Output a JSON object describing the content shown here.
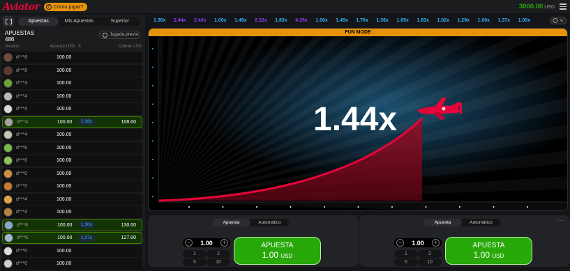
{
  "header": {
    "logo": "Aviator",
    "how_to_play": "Cómo jugar?",
    "balance": "3000.00",
    "currency": "USD"
  },
  "left_panel": {
    "tabs": [
      "Apuestas",
      "Mis Apuestas",
      "Superior"
    ],
    "active_tab": "Apuestas",
    "bets_title": "APUESTAS",
    "bets_count": "486",
    "previous_round": "Jugada previa",
    "columns": {
      "user": "Usuario",
      "bet": "Apuesta USD",
      "x": "X",
      "cashout": "Cobrar USD"
    },
    "rows": [
      {
        "user": "d***8",
        "bet": "100.00",
        "mult": "",
        "cashout": "",
        "win": false,
        "avatar": "#6e4b3a"
      },
      {
        "user": "d***8",
        "bet": "100.00",
        "mult": "",
        "cashout": "",
        "win": false,
        "avatar": "#5b3a2b"
      },
      {
        "user": "d***3",
        "bet": "100.00",
        "mult": "",
        "cashout": "",
        "win": false,
        "avatar": "#6da23a"
      },
      {
        "user": "d***4",
        "bet": "100.00",
        "mult": "",
        "cashout": "",
        "win": false,
        "avatar": "#b9b9b9"
      },
      {
        "user": "d***4",
        "bet": "100.00",
        "mult": "",
        "cashout": "",
        "win": false,
        "avatar": "#d9d9d9"
      },
      {
        "user": "d***4",
        "bet": "100.00",
        "mult": "1.08x",
        "cashout": "108.00",
        "win": true,
        "avatar": "#a7a29a"
      },
      {
        "user": "d***4",
        "bet": "100.00",
        "mult": "",
        "cashout": "",
        "win": false,
        "avatar": "#c2c8b8"
      },
      {
        "user": "d***6",
        "bet": "100.00",
        "mult": "",
        "cashout": "",
        "win": false,
        "avatar": "#7ab84a"
      },
      {
        "user": "d***6",
        "bet": "100.00",
        "mult": "",
        "cashout": "",
        "win": false,
        "avatar": "#8cc456"
      },
      {
        "user": "d***0",
        "bet": "100.00",
        "mult": "",
        "cashout": "",
        "win": false,
        "avatar": "#d28e3c"
      },
      {
        "user": "d***0",
        "bet": "100.00",
        "mult": "",
        "cashout": "",
        "win": false,
        "avatar": "#c97b2e"
      },
      {
        "user": "d***4",
        "bet": "100.00",
        "mult": "",
        "cashout": "",
        "win": false,
        "avatar": "#e0a24c"
      },
      {
        "user": "d***4",
        "bet": "100.00",
        "mult": "",
        "cashout": "",
        "win": false,
        "avatar": "#b7823d"
      },
      {
        "user": "d***6",
        "bet": "100.00",
        "mult": "1.30x",
        "cashout": "130.00",
        "win": true,
        "avatar": "#8aa8c8"
      },
      {
        "user": "d***6",
        "bet": "100.00",
        "mult": "1.27x",
        "cashout": "127.00",
        "win": true,
        "avatar": "#a3b8cc"
      },
      {
        "user": "d***0",
        "bet": "100.00",
        "mult": "",
        "cashout": "",
        "win": false,
        "avatar": "#dcdcdc"
      },
      {
        "user": "d***0",
        "bet": "100.00",
        "mult": "",
        "cashout": "",
        "win": false,
        "avatar": "#cfcfcf"
      }
    ]
  },
  "history": [
    {
      "v": "1.36x",
      "c": "#34b4ff"
    },
    {
      "v": "2.44x",
      "c": "#913ef8"
    },
    {
      "v": "2.43x",
      "c": "#913ef8"
    },
    {
      "v": "1.00x",
      "c": "#34b4ff"
    },
    {
      "v": "1.49x",
      "c": "#34b4ff"
    },
    {
      "v": "2.22x",
      "c": "#913ef8"
    },
    {
      "v": "1.83x",
      "c": "#34b4ff"
    },
    {
      "v": "4.35x",
      "c": "#913ef8"
    },
    {
      "v": "1.00x",
      "c": "#34b4ff"
    },
    {
      "v": "1.45x",
      "c": "#34b4ff"
    },
    {
      "v": "1.76x",
      "c": "#34b4ff"
    },
    {
      "v": "1.36x",
      "c": "#34b4ff"
    },
    {
      "v": "1.05x",
      "c": "#34b4ff"
    },
    {
      "v": "1.83x",
      "c": "#34b4ff"
    },
    {
      "v": "1.02x",
      "c": "#34b4ff"
    },
    {
      "v": "1.29x",
      "c": "#34b4ff"
    },
    {
      "v": "1.00x",
      "c": "#34b4ff"
    },
    {
      "v": "1.37x",
      "c": "#34b4ff"
    },
    {
      "v": "1.00x",
      "c": "#34b4ff"
    }
  ],
  "game": {
    "mode_banner": "FUN MODE",
    "multiplier": "1.44x",
    "colors": {
      "curve": "#e50539",
      "banner": "#e69308",
      "accent_green": "#28a909"
    }
  },
  "bet_panels": [
    {
      "tabs": [
        "Apuesta",
        "Automático"
      ],
      "active_tab": "Apuesta",
      "amount": "1.00",
      "quick": [
        "1",
        "2",
        "5",
        "10"
      ],
      "button_label": "APUESTA",
      "button_amount": "1.00",
      "button_currency": "USD"
    },
    {
      "tabs": [
        "Apuesta",
        "Automático"
      ],
      "active_tab": "Apuesta",
      "amount": "1.00",
      "quick": [
        "1",
        "2",
        "5",
        "10"
      ],
      "button_label": "APUESTA",
      "button_amount": "1.00",
      "button_currency": "USD"
    }
  ],
  "icons": {
    "fullscreen": "fullscreen-icon",
    "menu": "hamburger-menu-icon",
    "history": "clock-history-icon",
    "plane": "plane-icon"
  }
}
